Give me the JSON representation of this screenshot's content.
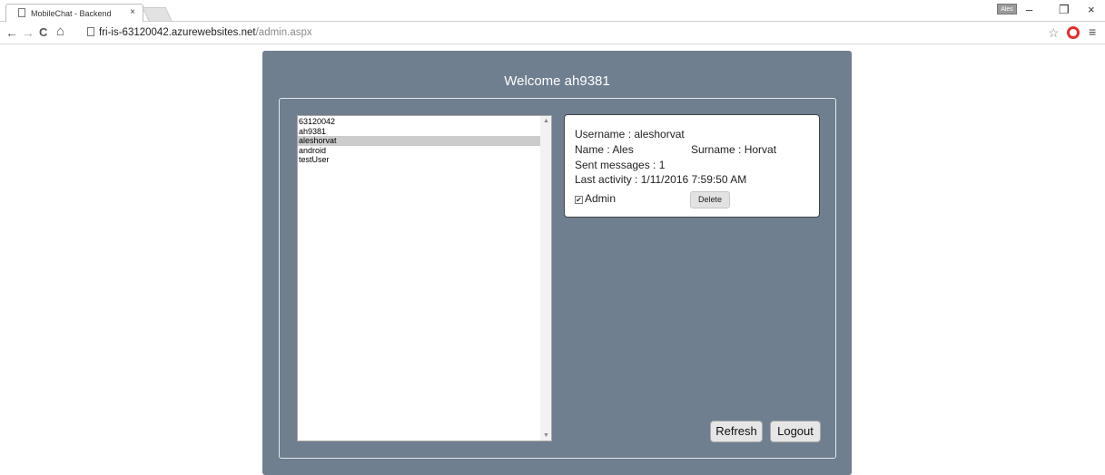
{
  "browser": {
    "tab_title": "MobileChat - Backend",
    "tab_close": "×",
    "user_badge": "Ales",
    "window_controls": {
      "minimize": "–",
      "restore": "❐",
      "close": "×"
    },
    "nav": {
      "back": "←",
      "forward": "→",
      "reload": "C",
      "home": "⌂"
    },
    "url_host": "fri-is-63120042.azurewebsites.net",
    "url_path": "/admin.aspx",
    "star": "☆",
    "menu": "≡"
  },
  "page": {
    "welcome": "Welcome ah9381",
    "users": [
      "63120042",
      "ah9381",
      "aleshorvat",
      "android",
      "testUser"
    ],
    "selected_user_index": 2,
    "details": {
      "username": "Username : aleshorvat",
      "name": "Name : Ales",
      "surname": "Surname : Horvat",
      "sent_messages": "Sent messages : 1",
      "last_activity": "Last activity : 1/11/2016 7:59:50 AM",
      "admin_label": "Admin",
      "admin_checked": true,
      "delete_label": "Delete"
    },
    "refresh_label": "Refresh",
    "logout_label": "Logout"
  },
  "colors": {
    "panel": "#6f7f8f",
    "selected_row": "#cccccc"
  }
}
